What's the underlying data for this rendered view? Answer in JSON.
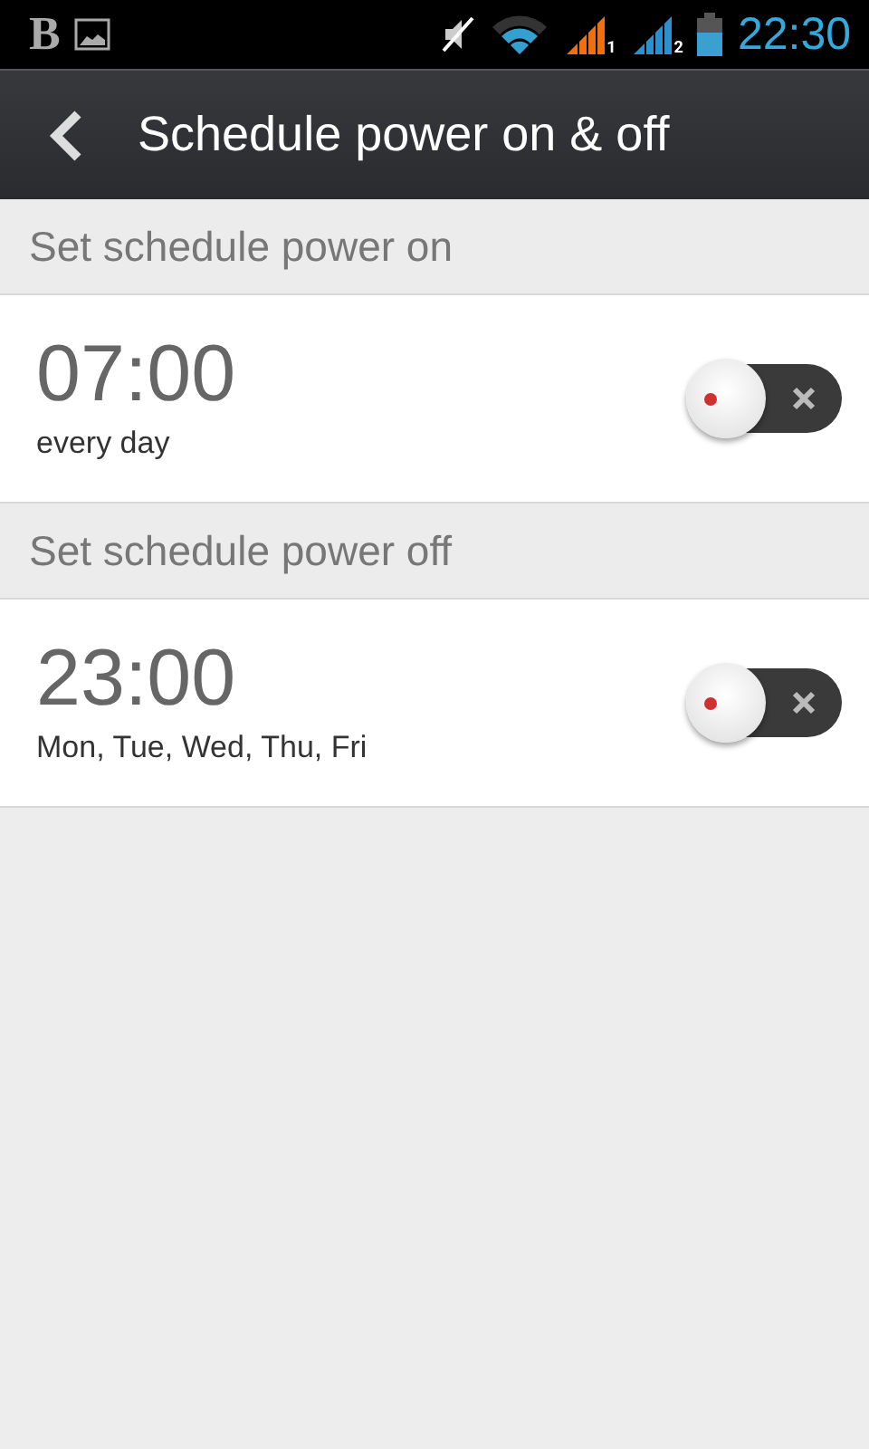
{
  "status_bar": {
    "notification_letter": "B",
    "sim_labels": [
      "1",
      "2"
    ],
    "time": "22:30"
  },
  "title_bar": {
    "title": "Schedule power on & off"
  },
  "sections": [
    {
      "header": "Set schedule power on",
      "time": "07:00",
      "repeat": "every day",
      "on": false
    },
    {
      "header": "Set schedule power off",
      "time": "23:00",
      "repeat": "Mon, Tue, Wed, Thu, Fri",
      "on": false
    }
  ]
}
